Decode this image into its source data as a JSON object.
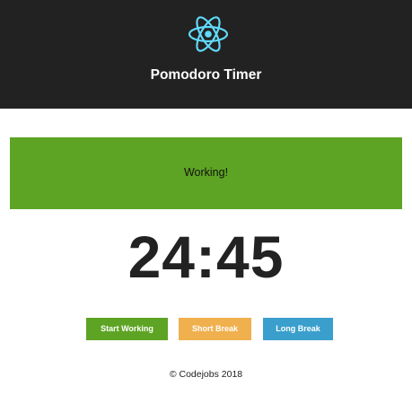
{
  "header": {
    "logo_icon": "react-atom-icon",
    "title": "Pomodoro Timer"
  },
  "status": {
    "text": "Working!"
  },
  "timer": {
    "display": "24:45"
  },
  "controls": {
    "start_working_label": "Start Working",
    "short_break_label": "Short Break",
    "long_break_label": "Long Break"
  },
  "footer": {
    "text": "© Codejobs 2018"
  },
  "colors": {
    "header_bg": "#222222",
    "working_green": "#5ea424",
    "short_break_orange": "#f0b04e",
    "long_break_blue": "#3a9fcd",
    "logo_cyan": "#61dafb"
  }
}
